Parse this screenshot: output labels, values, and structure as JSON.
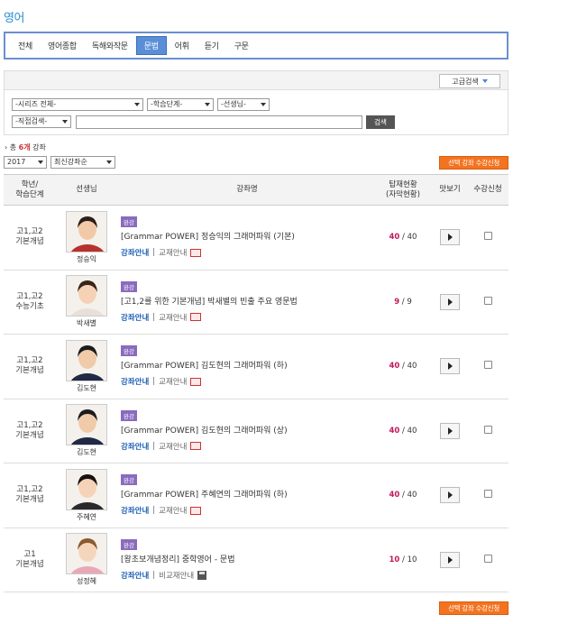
{
  "page_title": "영어",
  "tabs": [
    "전체",
    "영어종합",
    "독해와작문",
    "문법",
    "어휘",
    "듣기",
    "구문"
  ],
  "active_tab": "문법",
  "advanced_search_label": "고급검색",
  "filters": {
    "series": "-시리즈 전체-",
    "level": "-학습단계-",
    "teacher": "-선생님-",
    "direct": "-직접검색-",
    "search_button": "검색"
  },
  "total": {
    "prefix": "총",
    "count": "6개",
    "suffix": "강좌"
  },
  "year": "2017",
  "sort": "최신강좌순",
  "apply_label": "선택 강좌 수강신청",
  "headers": {
    "grade": [
      "학년/",
      "학습단계"
    ],
    "teacher": "선생님",
    "course": "강좌명",
    "status": [
      "탑재현황",
      "(자막현황)"
    ],
    "preview": "맛보기",
    "enroll": "수강신청"
  },
  "rows": [
    {
      "grade": [
        "고1,고2",
        "기본개념"
      ],
      "teacher": "정승익",
      "badge": "완강",
      "title": "[Grammar POWER] 정승익의 그래머파워 (기본)",
      "guide": "강좌안내",
      "material": "교재안내",
      "current": "40",
      "total": "40"
    },
    {
      "grade": [
        "고1,고2",
        "수능기초"
      ],
      "teacher": "박새별",
      "badge": "완강",
      "title": "[고1,2를 위한 기본개념] 박새별의 빈출 주요 영문법",
      "guide": "강좌안내",
      "material": "교재안내",
      "current": "9",
      "total": "9"
    },
    {
      "grade": [
        "고1,고2",
        "기본개념"
      ],
      "teacher": "김도현",
      "badge": "완강",
      "title": "[Grammar POWER] 김도현의 그래머파워 (하)",
      "guide": "강좌안내",
      "material": "교재안내",
      "current": "40",
      "total": "40"
    },
    {
      "grade": [
        "고1,고2",
        "기본개념"
      ],
      "teacher": "김도현",
      "badge": "완강",
      "title": "[Grammar POWER] 김도현의 그래머파워 (상)",
      "guide": "강좌안내",
      "material": "교재안내",
      "current": "40",
      "total": "40"
    },
    {
      "grade": [
        "고1,고2",
        "기본개념"
      ],
      "teacher": "주혜연",
      "badge": "완강",
      "title": "[Grammar POWER] 주혜연의 그래머파워 (하)",
      "guide": "강좌안내",
      "material": "교재안내",
      "current": "40",
      "total": "40"
    },
    {
      "grade": [
        "고1",
        "기본개념"
      ],
      "teacher": "성정혜",
      "badge": "완강",
      "title": "[왕초보개념정리] 중학영어 - 문법",
      "guide": "강좌안내",
      "material": "비교재안내",
      "current": "10",
      "total": "10",
      "material_icon": "floppy"
    }
  ],
  "colors": {
    "accent": "#2a8fcf",
    "tab_active": "#5a8fd8",
    "apply": "#f37320",
    "count": "#c2185b"
  }
}
